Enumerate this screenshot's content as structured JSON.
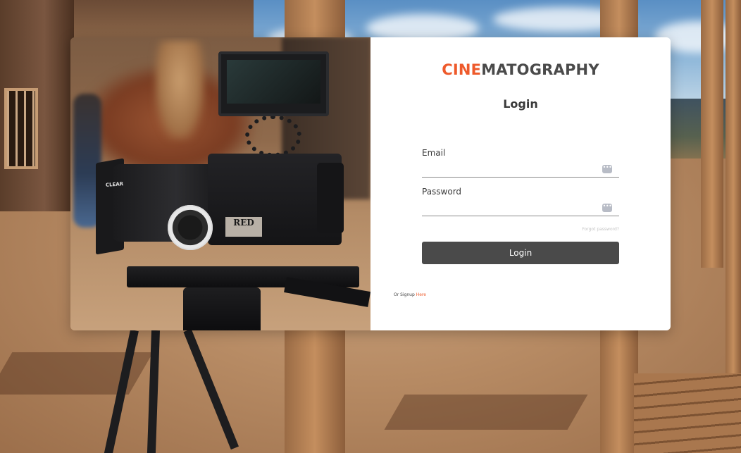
{
  "brand": {
    "accent": "CINE",
    "rest": "MATOGRAPHY",
    "accent_color": "#ee5a2b"
  },
  "login": {
    "title": "Login",
    "email_label": "Email",
    "email_value": "",
    "password_label": "Password",
    "password_value": "",
    "key_icon": "password-manager-key-icon",
    "forgot_password": "Forgot password?",
    "submit_label": "Login",
    "submit_color": "#4a4a4a"
  },
  "signup": {
    "prefix": "Or Signup",
    "link": "Here"
  },
  "photo": {
    "camera_label": "RED",
    "lens_label": "CLEAR"
  }
}
